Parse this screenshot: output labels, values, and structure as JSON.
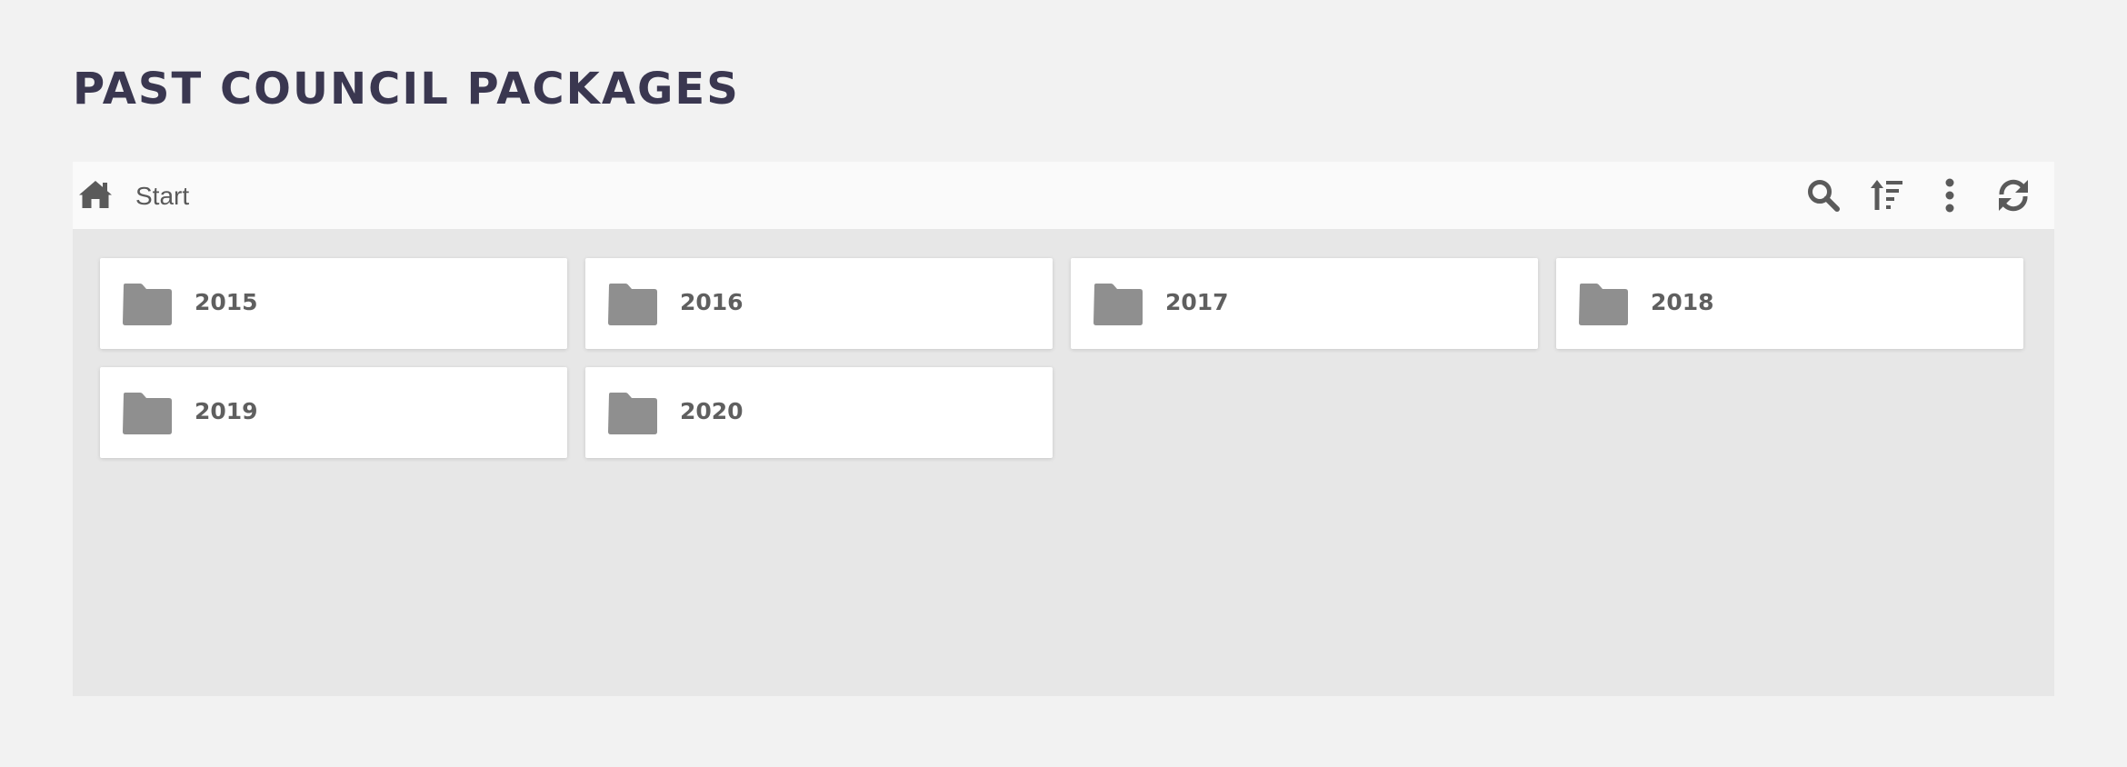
{
  "page": {
    "title": "PAST COUNCIL PACKAGES"
  },
  "toolbar": {
    "home_icon": "home-icon",
    "breadcrumb": "Start",
    "actions": [
      {
        "name": "search",
        "icon": "search-icon"
      },
      {
        "name": "sort",
        "icon": "sort-icon"
      },
      {
        "name": "more",
        "icon": "more-vertical-icon"
      },
      {
        "name": "refresh",
        "icon": "refresh-icon"
      }
    ]
  },
  "folders": [
    {
      "label": "2015"
    },
    {
      "label": "2016"
    },
    {
      "label": "2017"
    },
    {
      "label": "2018"
    },
    {
      "label": "2019"
    },
    {
      "label": "2020"
    }
  ],
  "colors": {
    "page_background": "#f2f2f2",
    "title": "#3a3750",
    "toolbar_background": "#fafafa",
    "content_background": "#e7e7e7",
    "icon": "#5a5a5a",
    "folder_icon": "#8f8f8f",
    "folder_label": "#5f5f5f"
  }
}
